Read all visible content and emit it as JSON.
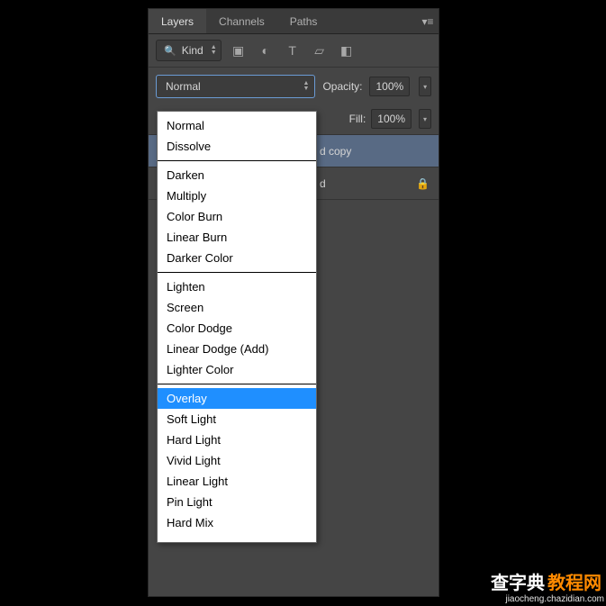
{
  "tabs": {
    "layers": "Layers",
    "channels": "Channels",
    "paths": "Paths"
  },
  "filter": {
    "kind": "Kind"
  },
  "blend": {
    "current": "Normal",
    "opacityLabel": "Opacity:",
    "opacityValue": "100%",
    "fillLabel": "Fill:",
    "fillValue": "100%"
  },
  "layers": {
    "item0": "d copy",
    "item1": "d"
  },
  "blendModes": {
    "g0": {
      "i0": "Normal",
      "i1": "Dissolve"
    },
    "g1": {
      "i0": "Darken",
      "i1": "Multiply",
      "i2": "Color Burn",
      "i3": "Linear Burn",
      "i4": "Darker Color"
    },
    "g2": {
      "i0": "Lighten",
      "i1": "Screen",
      "i2": "Color Dodge",
      "i3": "Linear Dodge (Add)",
      "i4": "Lighter Color"
    },
    "g3": {
      "i0": "Overlay",
      "i1": "Soft Light",
      "i2": "Hard Light",
      "i3": "Vivid Light",
      "i4": "Linear Light",
      "i5": "Pin Light",
      "i6": "Hard Mix"
    }
  },
  "watermark": {
    "main1": "查字典",
    "main2": "教程网",
    "sub": "jiaocheng.chazidian.com"
  }
}
